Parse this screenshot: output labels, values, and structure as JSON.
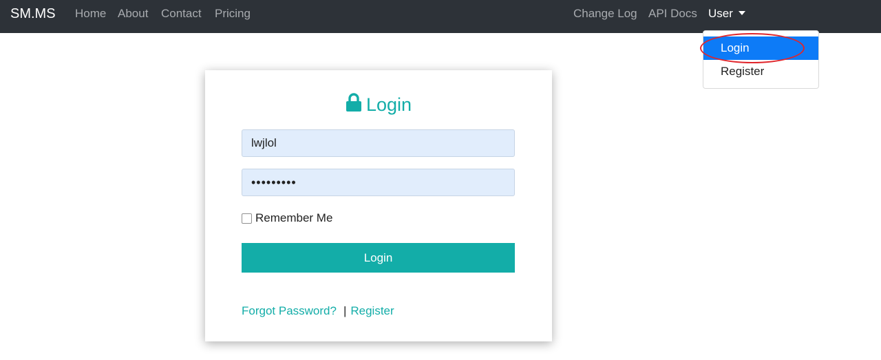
{
  "navbar": {
    "brand": "SM.MS",
    "left_links": [
      "Home",
      "About",
      "Contact",
      "Pricing"
    ],
    "right_links": [
      "Change Log",
      "API Docs"
    ],
    "user_menu": "User"
  },
  "dropdown": {
    "items": [
      "Login",
      "Register"
    ],
    "active_item": "Login"
  },
  "login_card": {
    "title": "Login",
    "username_value": "lwjlol",
    "password_value": "•••••••••",
    "remember_label": "Remember Me",
    "remember_checked": false,
    "submit_label": "Login",
    "forgot_link": "Forgot Password?",
    "separator": "|",
    "register_link": "Register"
  },
  "colors": {
    "navbar_bg": "#2d3238",
    "accent": "#13ada8",
    "dropdown_active": "#0d7bf7",
    "input_bg": "#e1edfc",
    "highlight": "#e0262c"
  },
  "icons": {
    "title_icon": "lock-icon",
    "user_caret": "caret-down-icon"
  }
}
